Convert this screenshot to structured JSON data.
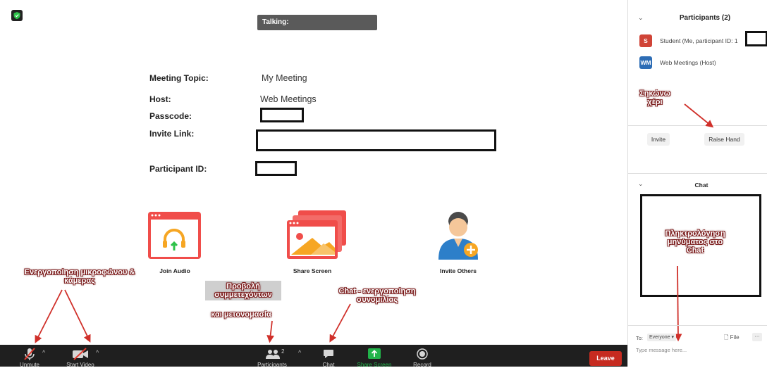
{
  "meeting": {
    "talking_label": "Talking:",
    "rows": [
      {
        "label": "Meeting Topic:",
        "value": "My Meeting"
      },
      {
        "label": "Host:",
        "value": "Web Meetings"
      },
      {
        "label": "Passcode:",
        "value": ""
      },
      {
        "label": "Invite Link:",
        "value": ""
      },
      {
        "label": "Participant ID:",
        "value": ""
      }
    ],
    "actions": [
      {
        "label": "Join Audio",
        "icon": "headphones-icon"
      },
      {
        "label": "Share Screen",
        "icon": "share-screen-icon"
      },
      {
        "label": "Invite Others",
        "icon": "invite-user-icon"
      }
    ]
  },
  "annotations": {
    "mic_cam": [
      "Ενεργοποίηση μικροφώνου &",
      "κάμερας"
    ],
    "participants": [
      "Προβολή",
      "συμμετεχόντων",
      "και μετονομασία"
    ],
    "chat": [
      "Chat - ενεργοποίηση",
      "συνομιλίας"
    ],
    "raise_hand": [
      "Σηκώνω",
      "χέρι"
    ],
    "chat_typing": [
      "Πληκτρολόγηση",
      "μηνύματος στο",
      "Chat"
    ]
  },
  "toolbar": {
    "unmute": "Unmute",
    "start_video": "Start Video",
    "participants": "Participants",
    "participants_count": "2",
    "chat": "Chat",
    "share_screen": "Share Screen",
    "record": "Record",
    "leave": "Leave",
    "colors": {
      "bg": "#1f1f1f",
      "share": "#21b34a",
      "leave": "#c62b20"
    }
  },
  "participants_panel": {
    "title": "Participants (2)",
    "people": [
      {
        "initials": "S",
        "name": "Student (Me, participant ID: 1",
        "color": "#d04437"
      },
      {
        "initials": "WM",
        "name": "Web Meetings (Host)",
        "color": "#2d6db5"
      }
    ],
    "invite": "Invite",
    "raise_hand": "Raise Hand"
  },
  "chat_panel": {
    "title": "Chat",
    "to_label": "To:",
    "to_value": "Everyone",
    "file_label": "File",
    "more_label": "···",
    "placeholder": "Type message here..."
  }
}
